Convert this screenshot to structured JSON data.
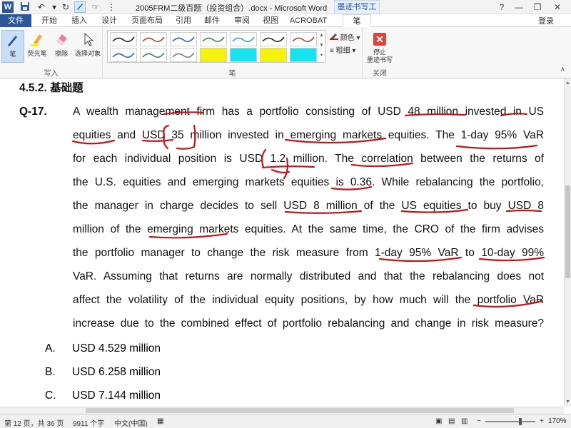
{
  "window": {
    "title": "2005FRM二级百题（投资组合）.docx - Microsoft Word",
    "context_tab": "墨迹书写工具",
    "login": "登录",
    "controls": [
      "?",
      "—",
      "❐",
      "✕"
    ]
  },
  "tabs": [
    "文件",
    "开始",
    "插入",
    "设计",
    "页面布局",
    "引用",
    "邮件",
    "审阅",
    "视图",
    "ACROBAT",
    "笔"
  ],
  "ribbon": {
    "write_group": {
      "label": "写入",
      "buttons": [
        "笔",
        "荧光笔",
        "擦除",
        "选择对象"
      ]
    },
    "pen_group": {
      "label": "笔",
      "color_label": "颜色",
      "weight_label": "粗细"
    },
    "close_group": {
      "label": "关闭",
      "stop_label_1": "停止",
      "stop_label_2": "墨迹书写"
    },
    "pen_colors": [
      "#222222",
      "#c0392b",
      "#2b5fcf",
      "#2e8b57",
      "#2ca6a8",
      "#222222",
      "#c0392b",
      "#2b5fcf",
      "#2e8b57",
      "#7a7a7a",
      "#f2f20a",
      "#19e2ef",
      "#f2f20a",
      "#19e2ef"
    ],
    "ink_color": "#c2161a"
  },
  "document": {
    "section_heading": "4.5.2.   基础题",
    "question_label": "Q-17.",
    "question_lines": [
      "A wealth management firm has a portfolio consisting of USD 48 million invested in US",
      "equities and USD 35 million invested in emerging markets equities. The 1-day 95% VaR",
      "for each individual position is USD 1.2 million. The correlation between the returns of",
      "the U.S. equities and emerging markets equities is 0.36. While rebalancing the portfolio,",
      "the manager in charge decides to sell USD 8 million of the US equities to buy USD 8",
      "million of the emerging markets equities. At the same time, the CRO of the firm advises",
      "the portfolio manager to change the risk measure from 1-day 95% VaR to 10-day 99%",
      "VaR. Assuming that returns are normally distributed and that the rebalancing does not",
      "affect the volatility of the individual equity positions, by how much will the portfolio VaR",
      "increase due to the combined effect of portfolio rebalancing and change in risk measure?"
    ],
    "options": [
      {
        "letter": "A.",
        "text": "USD 4.529 million"
      },
      {
        "letter": "B.",
        "text": "USD 6.258 million"
      },
      {
        "letter": "C.",
        "text": "USD 7.144 million"
      }
    ]
  },
  "status": {
    "page": "第 12 页，共 36 页",
    "words": "9911 个字",
    "language": "中文(中国)",
    "zoom": "170%"
  }
}
